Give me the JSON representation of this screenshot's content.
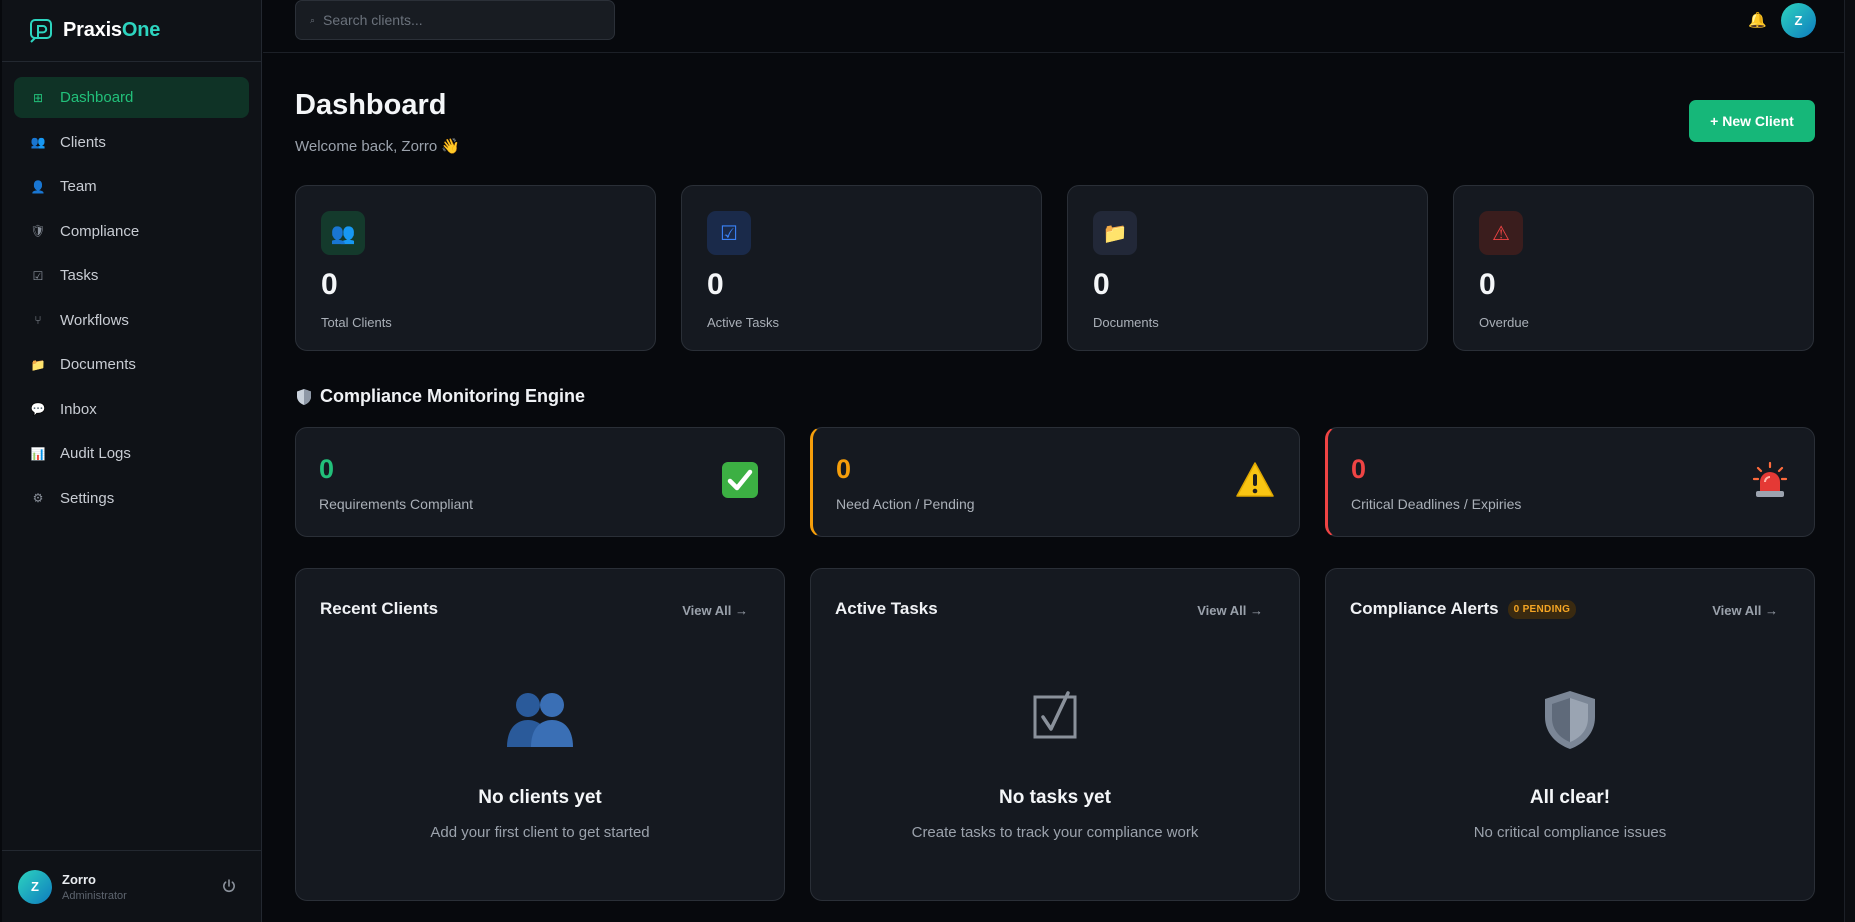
{
  "brand": {
    "name_part1": "Praxis",
    "name_part2": "One"
  },
  "sidebar": {
    "items": [
      {
        "label": "Dashboard",
        "icon": "grid-icon",
        "glyph": "⊞"
      },
      {
        "label": "Clients",
        "icon": "users-icon",
        "glyph": "👥"
      },
      {
        "label": "Team",
        "icon": "user-icon",
        "glyph": "👤"
      },
      {
        "label": "Compliance",
        "icon": "shield-icon",
        "glyph": "🛡"
      },
      {
        "label": "Tasks",
        "icon": "checkbox-icon",
        "glyph": "☑"
      },
      {
        "label": "Workflows",
        "icon": "branch-icon",
        "glyph": "⑂"
      },
      {
        "label": "Documents",
        "icon": "folder-icon",
        "glyph": "📁"
      },
      {
        "label": "Inbox",
        "icon": "chat-icon",
        "glyph": "💬"
      },
      {
        "label": "Audit Logs",
        "icon": "chart-icon",
        "glyph": "📊"
      },
      {
        "label": "Settings",
        "icon": "gear-icon",
        "glyph": "⚙"
      }
    ],
    "active_index": 0,
    "user": {
      "initial": "Z",
      "name": "Zorro",
      "role": "Administrator"
    }
  },
  "topbar": {
    "search_placeholder": "Search clients...",
    "avatar_initial": "Z"
  },
  "header": {
    "title": "Dashboard",
    "subtitle": "Welcome back, Zorro 👋",
    "new_client_label": "+ New Client"
  },
  "stats": [
    {
      "value": "0",
      "label": "Total Clients",
      "icon": "users-icon",
      "glyph": "👥",
      "bg": "#143a2c"
    },
    {
      "value": "0",
      "label": "Active Tasks",
      "icon": "checkbox-icon",
      "glyph": "☑",
      "bg": "#1a2a4a"
    },
    {
      "value": "0",
      "label": "Documents",
      "icon": "folder-icon",
      "glyph": "📁",
      "bg": "#222838"
    },
    {
      "value": "0",
      "label": "Overdue",
      "icon": "warning-icon",
      "glyph": "⚠",
      "bg": "#3a1d1d"
    }
  ],
  "compliance": {
    "section_title": "Compliance Monitoring Engine",
    "cards": [
      {
        "value": "0",
        "label": "Requirements Compliant",
        "color": "#22c07a",
        "icon": "check-emoji-icon"
      },
      {
        "value": "0",
        "label": "Need Action / Pending",
        "color": "#f59e0b",
        "icon": "warning-emoji-icon"
      },
      {
        "value": "0",
        "label": "Critical Deadlines / Expiries",
        "color": "#ef4444",
        "icon": "siren-emoji-icon"
      }
    ]
  },
  "panels": [
    {
      "title": "Recent Clients",
      "view_all": "View All →",
      "empty_title": "No clients yet",
      "empty_sub": "Add your first client to get started",
      "icon": "users-icon"
    },
    {
      "title": "Active Tasks",
      "view_all": "View All →",
      "empty_title": "No tasks yet",
      "empty_sub": "Create tasks to track your compliance work",
      "icon": "checkbox-icon"
    },
    {
      "title": "Compliance Alerts",
      "badge": "0 PENDING",
      "view_all": "View All →",
      "empty_title": "All clear!",
      "empty_sub": "No critical compliance issues",
      "icon": "shield-icon"
    }
  ]
}
